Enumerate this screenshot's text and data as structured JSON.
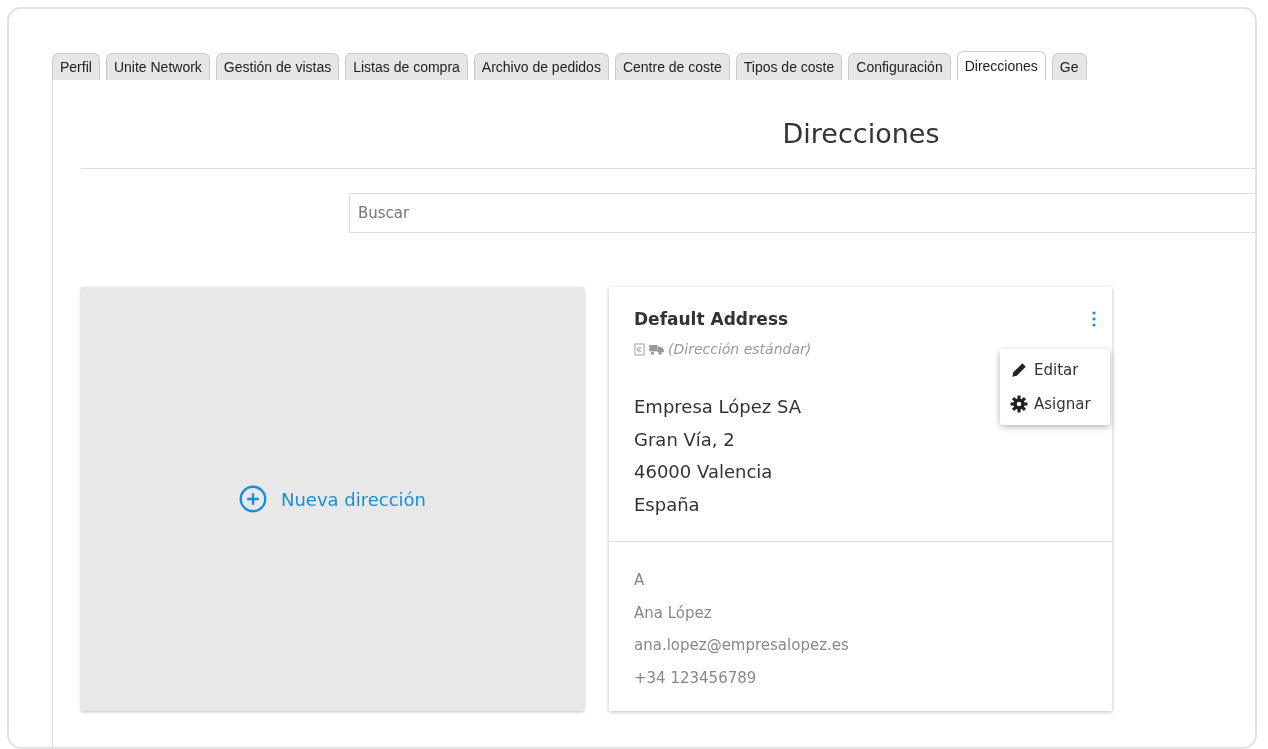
{
  "tabs": [
    {
      "label": "Perfil",
      "selected": false
    },
    {
      "label": "Unite Network",
      "selected": false
    },
    {
      "label": "Gestión de vistas",
      "selected": false
    },
    {
      "label": "Listas de compra",
      "selected": false
    },
    {
      "label": "Archivo de pedidos",
      "selected": false
    },
    {
      "label": "Centre de coste",
      "selected": false
    },
    {
      "label": "Tipos de coste",
      "selected": false
    },
    {
      "label": "Configuración",
      "selected": false
    },
    {
      "label": "Direcciones",
      "selected": true
    },
    {
      "label": "Ge",
      "selected": false
    }
  ],
  "page_title": "Direcciones",
  "search": {
    "placeholder": "Buscar"
  },
  "new_address": {
    "label": "Nueva dirección"
  },
  "address_card": {
    "title": "Default Address",
    "subtitle": "(Dirección estándar)",
    "address_lines": [
      "Empresa López SA",
      "Gran Vía, 2",
      "46000 Valencia",
      "España"
    ],
    "contact_lines": [
      "A",
      "Ana López",
      "ana.lopez@empresalopez.es",
      "+34 123456789"
    ],
    "menu": [
      {
        "kind": "edit",
        "label": "Editar"
      },
      {
        "kind": "assign",
        "label": "Asignar"
      }
    ]
  }
}
